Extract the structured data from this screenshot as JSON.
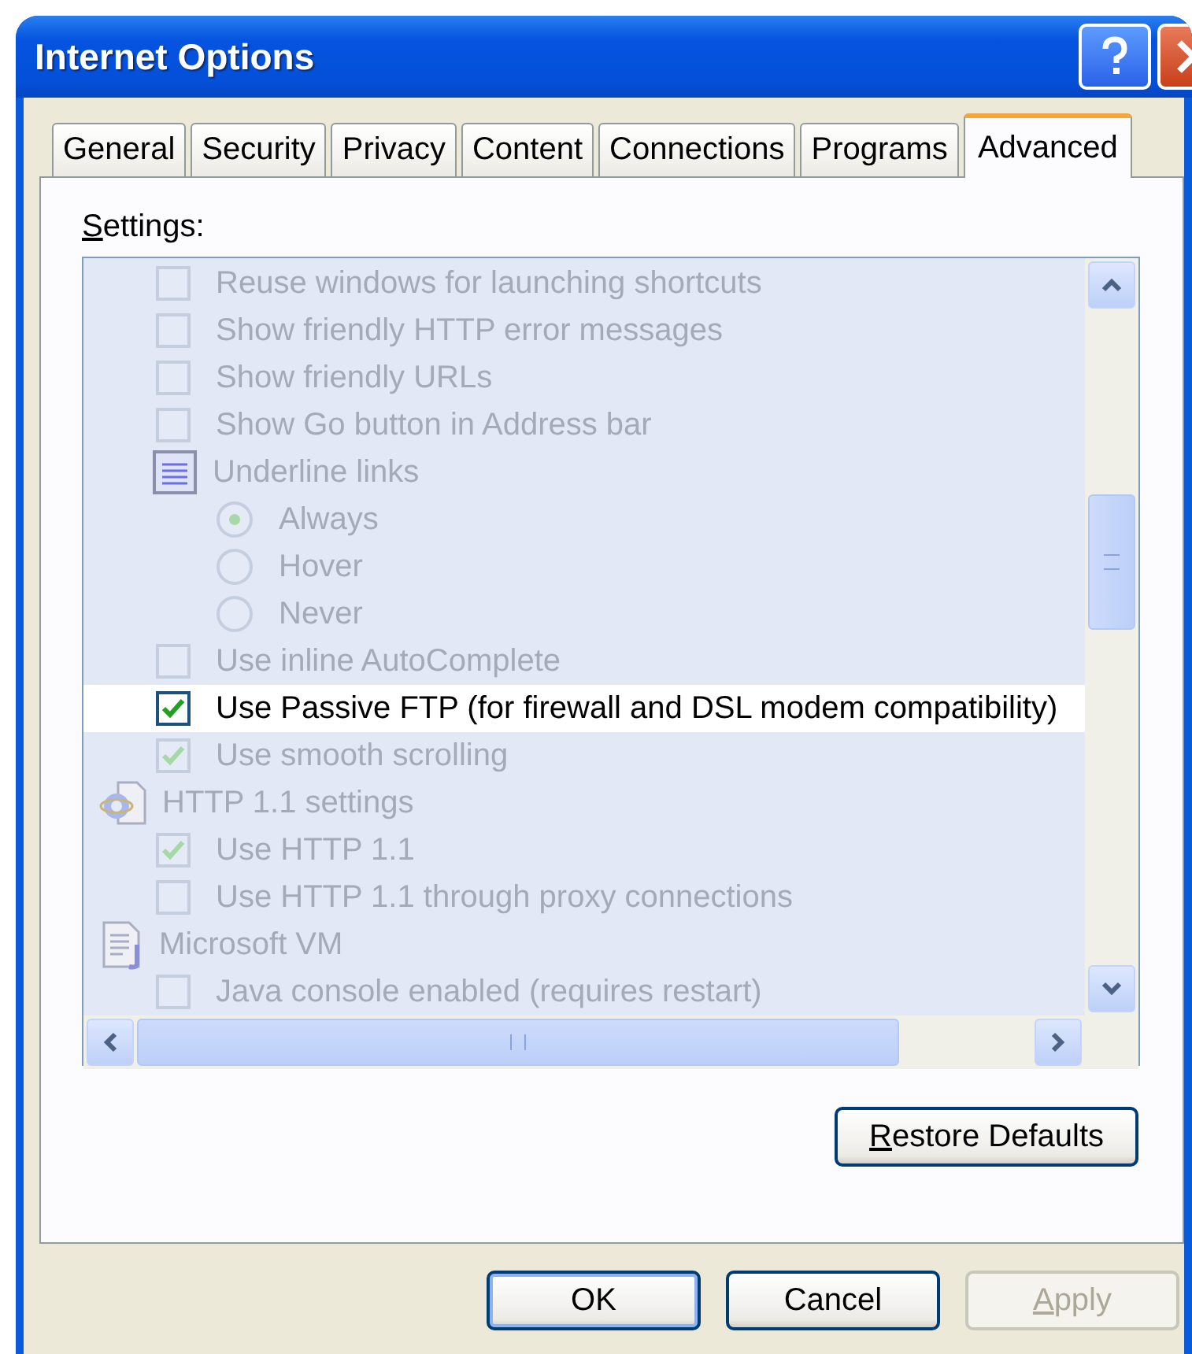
{
  "window": {
    "title": "Internet Options"
  },
  "tabs": [
    {
      "label": "General",
      "selected": false
    },
    {
      "label": "Security",
      "selected": false
    },
    {
      "label": "Privacy",
      "selected": false
    },
    {
      "label": "Content",
      "selected": false
    },
    {
      "label": "Connections",
      "selected": false
    },
    {
      "label": "Programs",
      "selected": false
    },
    {
      "label": "Advanced",
      "selected": true
    }
  ],
  "settings_label": "Settings:",
  "settings": [
    {
      "kind": "checkbox",
      "label": "Reuse windows for launching shortcuts",
      "checked": false,
      "disabled": true,
      "selected": false
    },
    {
      "kind": "checkbox",
      "label": "Show friendly HTTP error messages",
      "checked": false,
      "disabled": true,
      "selected": false
    },
    {
      "kind": "checkbox",
      "label": "Show friendly URLs",
      "checked": false,
      "disabled": true,
      "selected": false
    },
    {
      "kind": "checkbox",
      "label": "Show Go button in Address bar",
      "checked": false,
      "disabled": true,
      "selected": false
    },
    {
      "kind": "option_group",
      "label": "Underline links",
      "disabled": true,
      "selected": false,
      "children": [
        {
          "kind": "radio",
          "label": "Always",
          "checked": true,
          "disabled": true,
          "selected": false
        },
        {
          "kind": "radio",
          "label": "Hover",
          "checked": false,
          "disabled": true,
          "selected": false
        },
        {
          "kind": "radio",
          "label": "Never",
          "checked": false,
          "disabled": true,
          "selected": false
        }
      ]
    },
    {
      "kind": "checkbox",
      "label": "Use inline AutoComplete",
      "checked": false,
      "disabled": true,
      "selected": false
    },
    {
      "kind": "checkbox",
      "label": "Use Passive FTP (for firewall and DSL modem compatibility)",
      "checked": true,
      "disabled": false,
      "selected": true
    },
    {
      "kind": "checkbox",
      "label": "Use smooth scrolling",
      "checked": true,
      "disabled": true,
      "selected": false
    },
    {
      "kind": "web_category",
      "label": "HTTP 1.1 settings",
      "disabled": true,
      "selected": false,
      "children": [
        {
          "kind": "checkbox",
          "label": "Use HTTP 1.1",
          "checked": true,
          "disabled": true,
          "selected": false
        },
        {
          "kind": "checkbox",
          "label": "Use HTTP 1.1 through proxy connections",
          "checked": false,
          "disabled": true,
          "selected": false
        }
      ]
    },
    {
      "kind": "app_category",
      "label": "Microsoft VM",
      "disabled": true,
      "selected": false,
      "children": [
        {
          "kind": "checkbox",
          "label": "Java console enabled (requires restart)",
          "checked": false,
          "disabled": true,
          "selected": false
        }
      ]
    }
  ],
  "restore_button": {
    "label": "Restore Defaults"
  },
  "buttons": [
    {
      "label": "OK",
      "default": true,
      "disabled": false
    },
    {
      "label": "Cancel",
      "default": false,
      "disabled": false
    },
    {
      "label": "Apply",
      "default": false,
      "disabled": true
    }
  ]
}
